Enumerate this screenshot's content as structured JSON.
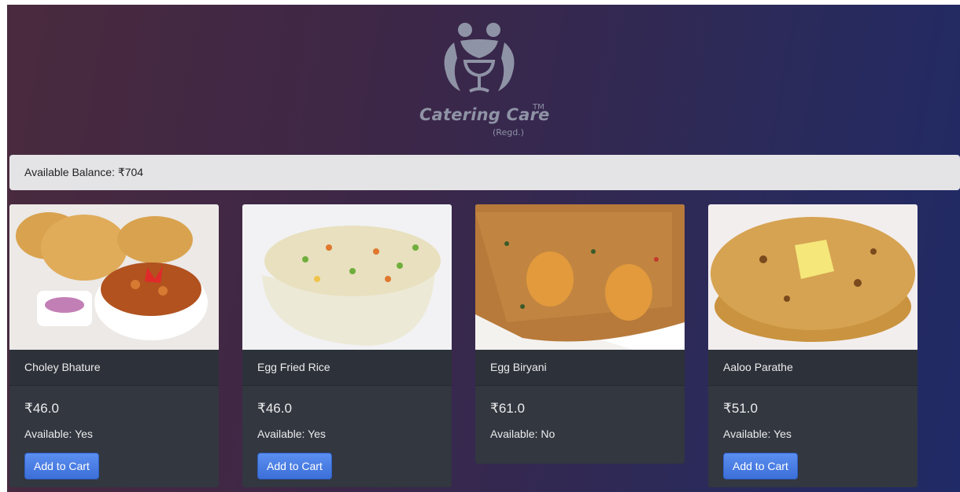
{
  "brand": {
    "name": "Catering Care",
    "trademark": "TM",
    "suffix": "(Regd.)"
  },
  "balance": {
    "text": "Available Balance: ₹704"
  },
  "menu": {
    "items": [
      {
        "name": "Choley Bhature",
        "price": "₹46.0",
        "availability": "Available: Yes",
        "button": "Add to Cart",
        "image": "choley-bhature-photo"
      },
      {
        "name": "Egg Fried Rice",
        "price": "₹46.0",
        "availability": "Available: Yes",
        "button": "Add to Cart",
        "image": "egg-fried-rice-photo"
      },
      {
        "name": "Egg Biryani",
        "price": "₹61.0",
        "availability": "Available: No",
        "image": "egg-biryani-photo"
      },
      {
        "name": "Aaloo Parathe",
        "price": "₹51.0",
        "availability": "Available: Yes",
        "button": "Add to Cart",
        "image": "aaloo-parathe-photo"
      }
    ]
  },
  "colors": {
    "card_bg": "#323740",
    "button": "#4a7fe6"
  }
}
